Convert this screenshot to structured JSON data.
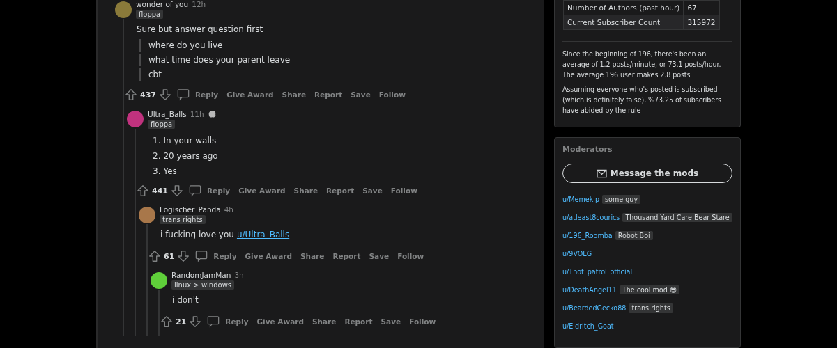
{
  "comments": [
    {
      "author": "wonder of you",
      "time": "12h",
      "award": false,
      "color": "#8a7a3a",
      "flair": "floppa",
      "votes": "437",
      "blocks": [
        {
          "kind": "paragraph",
          "text": "Sure but answer question first"
        },
        {
          "kind": "quote",
          "text": "where do you live"
        },
        {
          "kind": "quote",
          "text": "what time does your parent leave"
        },
        {
          "kind": "quote",
          "text": "cbt"
        }
      ],
      "actions": [
        "Reply",
        "Give Award",
        "Share",
        "Report",
        "Save",
        "Follow"
      ],
      "children": [
        {
          "author": "Ultra_Balls",
          "time": "11h",
          "award": true,
          "color": "#c0327e",
          "flair": "floppa",
          "votes": "441",
          "blocks": [
            {
              "kind": "list_item",
              "number": "1.",
              "text": "In your walls"
            },
            {
              "kind": "list_item",
              "number": "2.",
              "text": "20 years ago"
            },
            {
              "kind": "list_item",
              "number": "3.",
              "text": "Yes"
            }
          ],
          "actions": [
            "Reply",
            "Give Award",
            "Share",
            "Report",
            "Save",
            "Follow"
          ],
          "children": [
            {
              "author": "Logischer_Panda",
              "time": "4h",
              "award": false,
              "color": "#a8774a",
              "flair": "trans rights",
              "votes": "61",
              "blocks": [
                {
                  "kind": "mention",
                  "text": "i fucking love you",
                  "link": "u/Ultra_Balls"
                }
              ],
              "actions": [
                "Reply",
                "Give Award",
                "Share",
                "Report",
                "Save",
                "Follow"
              ],
              "children": [
                {
                  "author": "RandomJamMan",
                  "time": "3h",
                  "award": false,
                  "color": "#5fcf3a",
                  "flair": "linux > windows",
                  "votes": "21",
                  "blocks": [
                    {
                      "kind": "paragraph",
                      "text": "i don't"
                    }
                  ],
                  "actions": [
                    "Reply",
                    "Give Award",
                    "Share",
                    "Report",
                    "Save",
                    "Follow"
                  ]
                }
              ]
            }
          ]
        }
      ]
    }
  ],
  "stats": {
    "rows": [
      {
        "label": "Number of Authors (past hour)",
        "value": "67"
      },
      {
        "label": "Current Subscriber Count",
        "value": "315972"
      }
    ],
    "paragraphs": [
      "Since the beginning of 196, there's been an average of 1.2 posts/minute, or 73.1 posts/hour. The average 196 user makes 2.8 posts",
      "Assuming everyone who's posted is subscribed (which is definitely false), %73.25 of subscribers have abided by the rule"
    ]
  },
  "moderators": {
    "title": "Moderators",
    "button": "Message the mods",
    "items": [
      {
        "user": "u/Memekip",
        "flair": "some guy"
      },
      {
        "user": "u/atleast8courics",
        "flair": "Thousand Yard Care Bear Stare"
      },
      {
        "user": "u/196_Roomba",
        "flair": "Robot Boi"
      },
      {
        "user": "u/9VOLG"
      },
      {
        "user": "u/Thot_patrol_official"
      },
      {
        "user": "u/DeathAngel11",
        "flair": "The cool mod 😎"
      },
      {
        "user": "u/BeardedGecko88",
        "flair": "trans rights"
      },
      {
        "user": "u/Eldritch_Goat"
      }
    ]
  }
}
